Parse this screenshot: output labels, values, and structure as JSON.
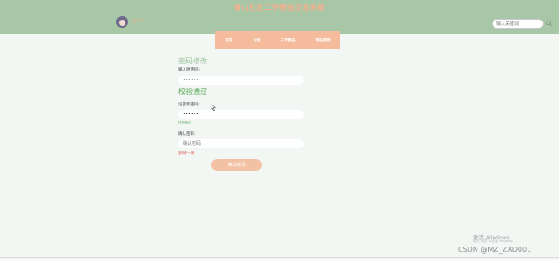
{
  "header": {
    "site_title": "萧山社区二手物品交易系统",
    "username": "用户1",
    "search_placeholder": "输入关键词"
  },
  "nav": {
    "items": [
      "首页",
      "公告",
      "二手商品",
      "物品收购"
    ]
  },
  "form": {
    "section_title": "密码修改",
    "old_password_label": "输入原密码:",
    "old_password_value": "••••••",
    "verify_title": "校验通过",
    "new_password_label": "设置新密码:",
    "new_password_value": "••••••",
    "new_password_hint": "校验通过",
    "confirm_password_label": "确认密码:",
    "confirm_password_placeholder": "确认密码",
    "confirm_password_hint": "密码不一致",
    "submit_label": "确认修改"
  },
  "watermark": {
    "activate_windows": "激活 Windows",
    "activate_hint": "转到“设置”以激活 Windows",
    "csdn": "CSDN @MZ_ZXD001"
  },
  "colors": {
    "header_bg": "#a8c7a6",
    "accent": "#f3b08f",
    "nav_bg": "#f4bb9c",
    "page_bg": "#f2f7f4",
    "success": "#56a857",
    "error": "#d9534f"
  }
}
